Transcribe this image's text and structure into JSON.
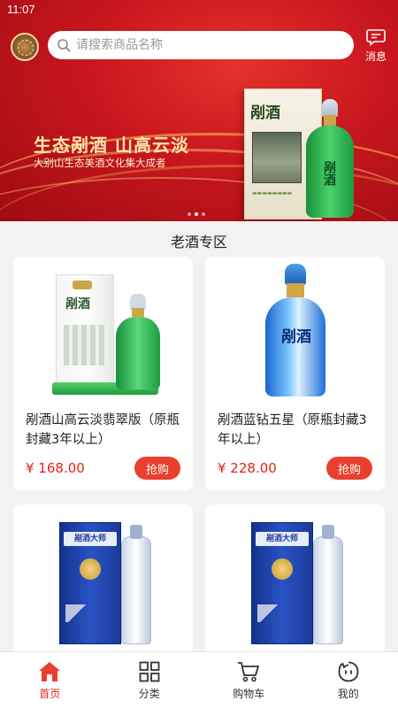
{
  "status_bar": {
    "time": "11:07"
  },
  "header": {
    "search_placeholder": "请搜索商品名称",
    "message_label": "消息"
  },
  "banner": {
    "slogan": "生态剐酒  山高云淡",
    "sub_slogan": "大别山生态美酒文化集大成者",
    "box_title": "剐酒",
    "bottle_title": "剐酒",
    "slide_count": 3,
    "active_slide": 2
  },
  "section": {
    "title": "老酒专区"
  },
  "products": [
    {
      "name": "剐酒山高云淡翡翠版（原瓶封藏3年以上）",
      "price": "¥ 168.00",
      "buy_label": "抢购",
      "art_text": "剐酒"
    },
    {
      "name": "剐酒蓝钻五星（原瓶封藏3年以上）",
      "price": "¥ 228.00",
      "buy_label": "抢购",
      "art_text": "剐酒"
    },
    {
      "name": "",
      "price": "",
      "buy_label": "",
      "art_text": "剐酒大师"
    },
    {
      "name": "",
      "price": "",
      "buy_label": "",
      "art_text": "剐酒大师"
    }
  ],
  "tabbar": {
    "items": [
      {
        "label": "首页",
        "icon": "home-icon",
        "active": true
      },
      {
        "label": "分类",
        "icon": "grid-icon",
        "active": false
      },
      {
        "label": "购物车",
        "icon": "cart-icon",
        "active": false
      },
      {
        "label": "我的",
        "icon": "profile-icon",
        "active": false
      }
    ],
    "active_color": "#e2231a"
  },
  "colors": {
    "brand_red": "#c8161d",
    "buy_button": "#e8402e",
    "price": "#e2231a"
  }
}
